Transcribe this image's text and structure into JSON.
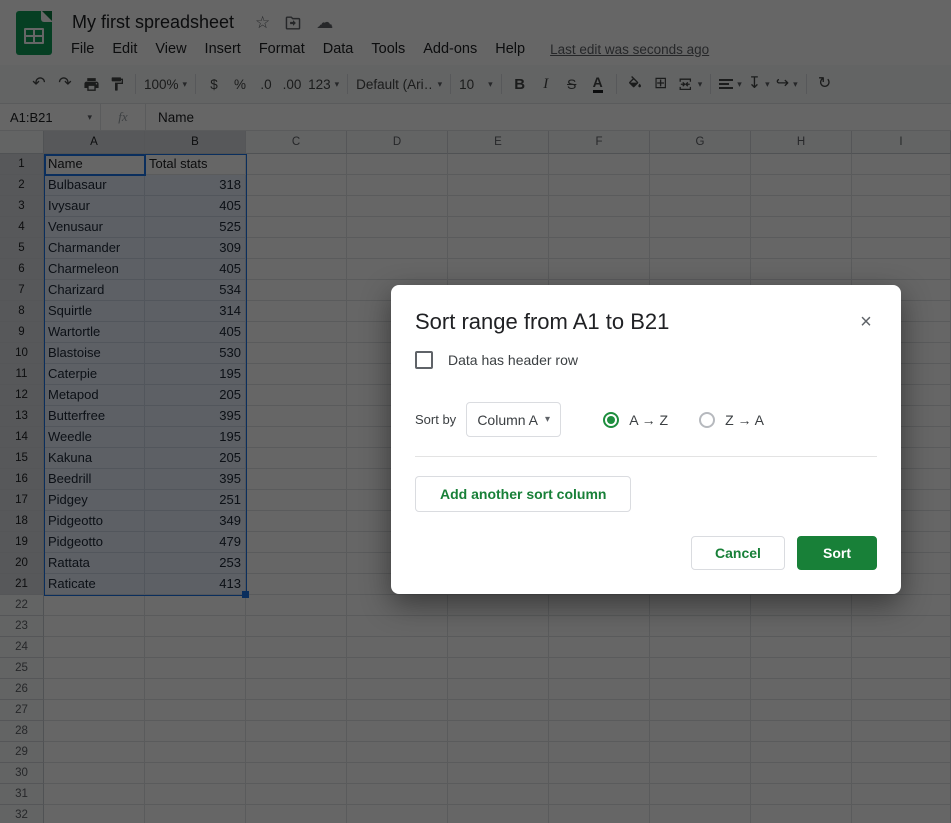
{
  "titlebar": {
    "title": "My first spreadsheet",
    "menu": [
      "File",
      "Edit",
      "View",
      "Insert",
      "Format",
      "Data",
      "Tools",
      "Add-ons",
      "Help"
    ],
    "last_edit": "Last edit was seconds ago"
  },
  "icons": {
    "star": "☆",
    "cloud_saved": "☁",
    "undo": "↶",
    "redo": "↷",
    "borders": "⊞",
    "vertical_align": "↧",
    "text_wrap": "↪",
    "text_rotation": "↻",
    "caret_down": "▾",
    "close": "×"
  },
  "toolbar": {
    "zoom": "100%",
    "currency": "$",
    "percent": "%",
    "decrease_decimal": ".0",
    "increase_decimal": ".00",
    "more_formats": "123",
    "font": "Default (Ari…",
    "font_size": "10",
    "bold": "B",
    "italic": "I",
    "strikethrough": "S",
    "text_color": "A"
  },
  "formula_bar": {
    "name_box": "A1:B21",
    "fx": "fx",
    "value": "Name"
  },
  "sheet": {
    "columns": [
      "A",
      "B",
      "C",
      "D",
      "E",
      "F",
      "G",
      "H",
      "I"
    ],
    "selected_columns": [
      "A",
      "B"
    ],
    "row_count": 32,
    "selected_rows_through": 21,
    "selection": {
      "range": "A1:B21",
      "active_cell": "A1"
    },
    "data": [
      [
        "Name",
        "Total stats"
      ],
      [
        "Bulbasaur",
        "318"
      ],
      [
        "Ivysaur",
        "405"
      ],
      [
        "Venusaur",
        "525"
      ],
      [
        "Charmander",
        "309"
      ],
      [
        "Charmeleon",
        "405"
      ],
      [
        "Charizard",
        "534"
      ],
      [
        "Squirtle",
        "314"
      ],
      [
        "Wartortle",
        "405"
      ],
      [
        "Blastoise",
        "530"
      ],
      [
        "Caterpie",
        "195"
      ],
      [
        "Metapod",
        "205"
      ],
      [
        "Butterfree",
        "395"
      ],
      [
        "Weedle",
        "195"
      ],
      [
        "Kakuna",
        "205"
      ],
      [
        "Beedrill",
        "395"
      ],
      [
        "Pidgey",
        "251"
      ],
      [
        "Pidgeotto",
        "349"
      ],
      [
        "Pidgeotto",
        "479"
      ],
      [
        "Rattata",
        "253"
      ],
      [
        "Raticate",
        "413"
      ]
    ]
  },
  "dialog": {
    "title": "Sort range from A1 to B21",
    "header_checkbox_label": "Data has header row",
    "header_checkbox_checked": false,
    "sort_by_label": "Sort by",
    "column_select_value": "Column A",
    "ascending_label": "A → Z",
    "descending_label": "Z → A",
    "ascending_selected": true,
    "add_column_label": "Add another sort column",
    "cancel_label": "Cancel",
    "sort_label": "Sort"
  },
  "colors": {
    "brand_green": "#0f9d58",
    "button_green": "#188038",
    "radio_green": "#1e8e3e",
    "selection_blue": "#1a73e8",
    "dim_overlay": "rgba(0,0,0,0.6)"
  }
}
